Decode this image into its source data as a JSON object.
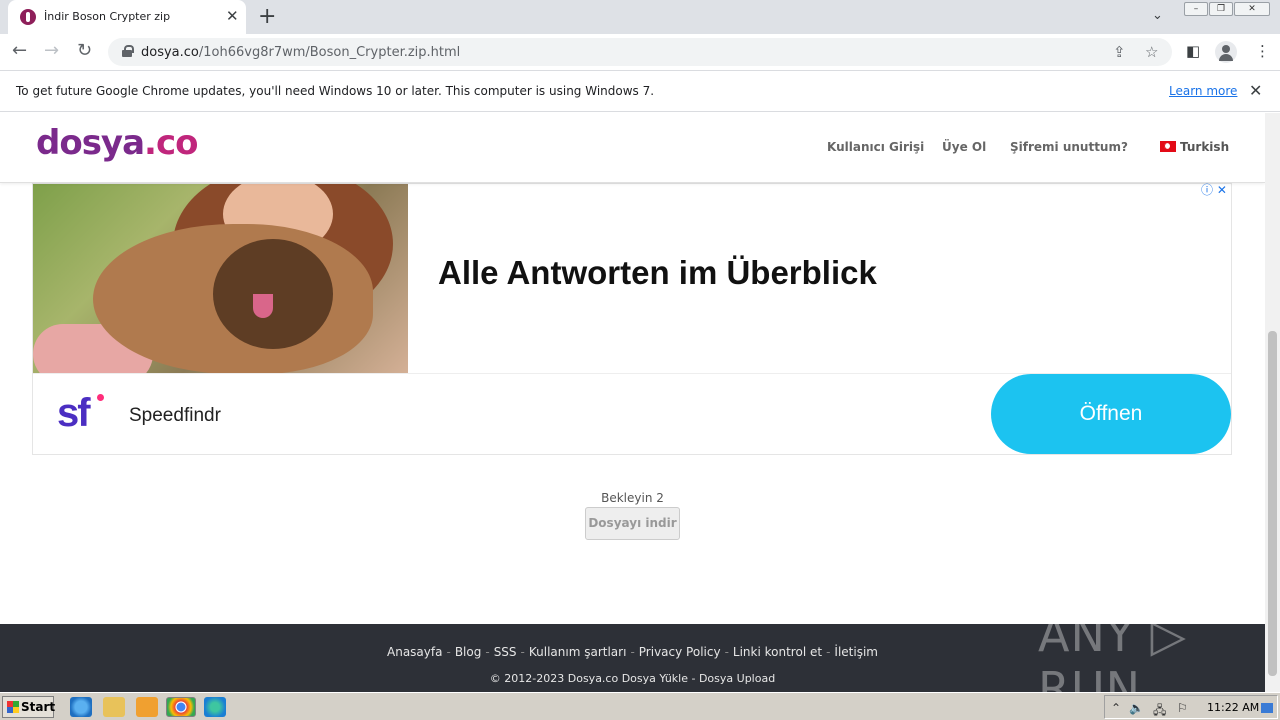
{
  "browser": {
    "tab_title": "İndir Boson Crypter zip",
    "tab_close": "✕",
    "new_tab": "+",
    "url_host": "dosya.co",
    "url_path": "/1oh66vg8r7wm/Boson_Crypter.zip.html",
    "infobar_text": "To get future Google Chrome updates, you'll need Windows 10 or later. This computer is using Windows 7.",
    "infobar_link": "Learn more"
  },
  "site": {
    "logo_a": "dosya",
    "logo_b": ".co",
    "nav": [
      "Kullanıcı Girişi",
      "Üye Ol",
      "Şifremi unuttum?"
    ],
    "language": "Turkish"
  },
  "ad": {
    "headline": "Alle Antworten im Überblick",
    "brand_logo": "sf",
    "brand_name": "Speedfindr",
    "cta": "Öffnen"
  },
  "download": {
    "wait_text": "Bekleyin 2",
    "button_label": "Dosyayı indir"
  },
  "footer": {
    "links": [
      "Anasayfa",
      "Blog",
      "SSS",
      "Kullanım şartları",
      "Privacy Policy",
      "Linki kontrol et",
      "İletişim"
    ],
    "copyright": "© 2012-2023 Dosya.co Dosya Yükle - Dosya Upload",
    "watermark": "ANY ▷ RUN"
  },
  "taskbar": {
    "start_label": "Start",
    "clock": "11:22 AM"
  },
  "colors": {
    "brand_purple": "#7b2a8c",
    "brand_pink": "#c0267c",
    "cta_blue": "#1cc3f0",
    "footer_bg": "#2d3037"
  }
}
